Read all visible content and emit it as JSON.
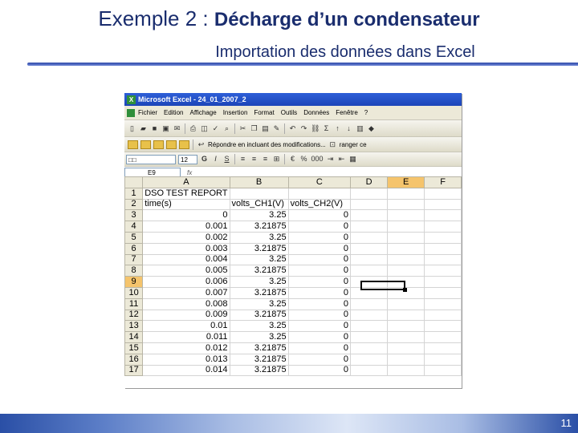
{
  "slide": {
    "title_part1": "Exemple 2 : ",
    "title_part2": "Décharge d’un condensateur",
    "subtitle": "Importation des données dans Excel",
    "page_number": "11"
  },
  "excel": {
    "window_title": "Microsoft Excel - 24_01_2007_2",
    "logo_letter": "X",
    "menu": [
      "Fichier",
      "Edition",
      "Affichage",
      "Insertion",
      "Format",
      "Outils",
      "Données",
      "Fenêtre",
      "?"
    ],
    "toolbar2_text": "Répondre en incluant des modifications...",
    "toolbar2_text2": "ranger ce",
    "font_box": "□□",
    "font_size": "12",
    "bold": "G",
    "italic": "I",
    "underline": "S",
    "percent": "%",
    "thousands": "000",
    "name_box": "E9",
    "fx_label": "fx",
    "columns": [
      "A",
      "B",
      "C",
      "D",
      "E",
      "F"
    ],
    "selected_column": "E",
    "selected_row": "9",
    "rows": [
      {
        "n": "1",
        "a": "DSO TEST REPORT",
        "b": "",
        "c": ""
      },
      {
        "n": "2",
        "a": "time(s)",
        "b": "volts_CH1(V)",
        "c": "volts_CH2(V)"
      },
      {
        "n": "3",
        "a": "0",
        "b": "3.25",
        "c": "0"
      },
      {
        "n": "4",
        "a": "0.001",
        "b": "3.21875",
        "c": "0"
      },
      {
        "n": "5",
        "a": "0.002",
        "b": "3.25",
        "c": "0"
      },
      {
        "n": "6",
        "a": "0.003",
        "b": "3.21875",
        "c": "0"
      },
      {
        "n": "7",
        "a": "0.004",
        "b": "3.25",
        "c": "0"
      },
      {
        "n": "8",
        "a": "0.005",
        "b": "3.21875",
        "c": "0"
      },
      {
        "n": "9",
        "a": "0.006",
        "b": "3.25",
        "c": "0"
      },
      {
        "n": "10",
        "a": "0.007",
        "b": "3.21875",
        "c": "0"
      },
      {
        "n": "11",
        "a": "0.008",
        "b": "3.25",
        "c": "0"
      },
      {
        "n": "12",
        "a": "0.009",
        "b": "3.21875",
        "c": "0"
      },
      {
        "n": "13",
        "a": "0.01",
        "b": "3.25",
        "c": "0"
      },
      {
        "n": "14",
        "a": "0.011",
        "b": "3.25",
        "c": "0"
      },
      {
        "n": "15",
        "a": "0.012",
        "b": "3.21875",
        "c": "0"
      },
      {
        "n": "16",
        "a": "0.013",
        "b": "3.21875",
        "c": "0"
      },
      {
        "n": "17",
        "a": "0.014",
        "b": "3.21875",
        "c": "0"
      }
    ]
  },
  "colors": {
    "title": "#1a2d6e",
    "excel_title_bar": "#2e5fd8",
    "selected_header": "#f5c46c"
  }
}
